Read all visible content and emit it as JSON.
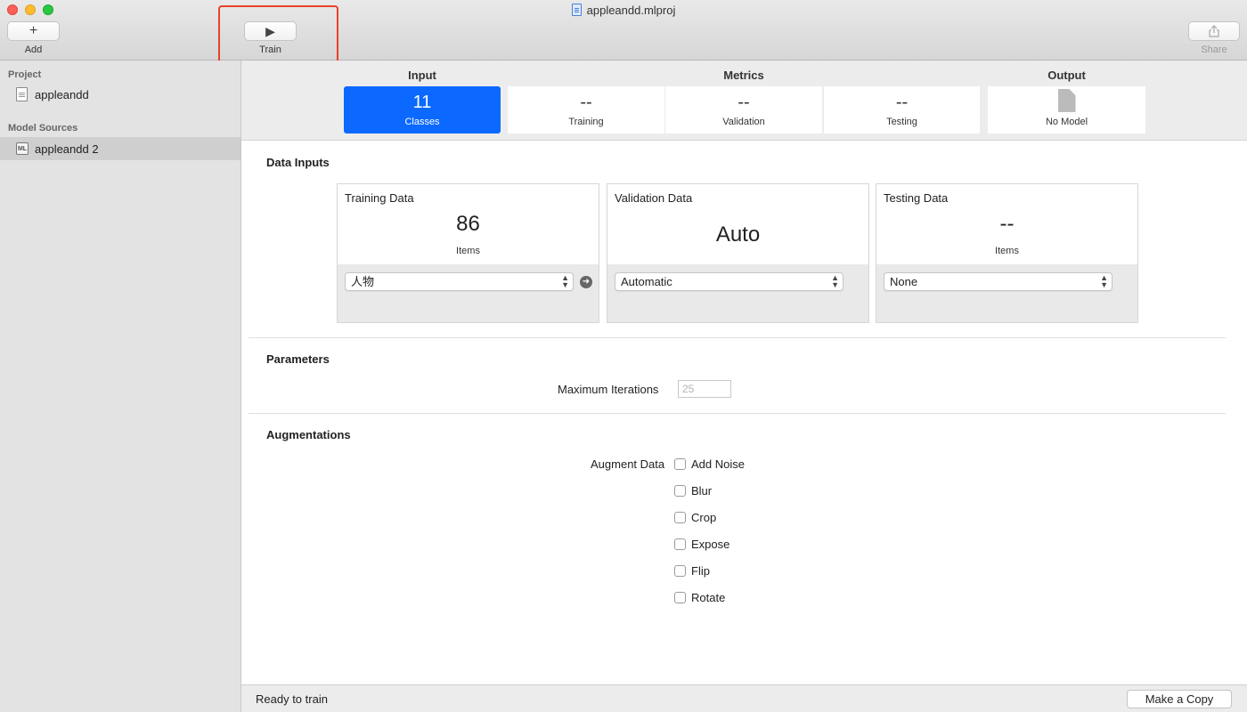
{
  "window": {
    "title": "appleandd.mlproj"
  },
  "toolbar": {
    "add_label": "Add",
    "train_label": "Train",
    "share_label": "Share"
  },
  "sidebar": {
    "project_header": "Project",
    "project_item": "appleandd",
    "sources_header": "Model Sources",
    "source_item": "appleandd 2",
    "ml_badge": "ML"
  },
  "summary": {
    "input_header": "Input",
    "metrics_header": "Metrics",
    "output_header": "Output",
    "classes_value": "11",
    "classes_label": "Classes",
    "training_value": "--",
    "training_label": "Training",
    "validation_value": "--",
    "validation_label": "Validation",
    "testing_value": "--",
    "testing_label": "Testing",
    "output_label": "No Model"
  },
  "data_inputs": {
    "title": "Data Inputs",
    "training": {
      "title": "Training Data",
      "value": "86",
      "unit": "Items",
      "selected": "人物"
    },
    "validation": {
      "title": "Validation Data",
      "value": "Auto",
      "selected": "Automatic"
    },
    "testing": {
      "title": "Testing Data",
      "value": "--",
      "unit": "Items",
      "selected": "None"
    }
  },
  "parameters": {
    "title": "Parameters",
    "max_iterations_label": "Maximum Iterations",
    "max_iterations_placeholder": "25"
  },
  "augmentations": {
    "title": "Augmentations",
    "label": "Augment Data",
    "options": [
      "Add Noise",
      "Blur",
      "Crop",
      "Expose",
      "Flip",
      "Rotate"
    ]
  },
  "footer": {
    "status": "Ready to train",
    "make_copy_label": "Make a Copy"
  },
  "colors": {
    "accent": "#0b69ff",
    "highlight": "#e9412a"
  }
}
